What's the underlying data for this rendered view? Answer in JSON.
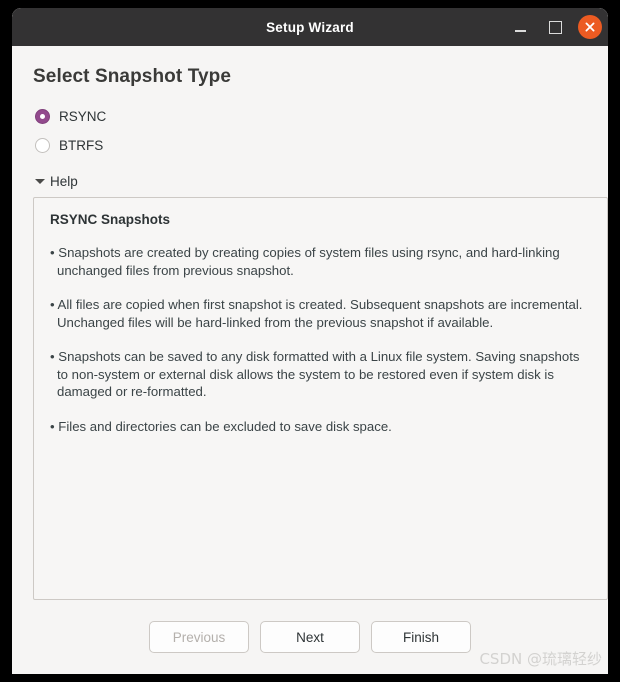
{
  "window": {
    "title": "Setup Wizard",
    "controls": {
      "minimize": "minimize",
      "maximize": "maximize",
      "close": "close"
    },
    "close_button_color": "#ec5b22",
    "titlebar_color": "#333233"
  },
  "page": {
    "title": "Select Snapshot Type",
    "accent_color": "#924a8d",
    "background_color": "#f6f5f4"
  },
  "snapshot_type": {
    "selected": "RSYNC",
    "options": [
      {
        "label": "RSYNC",
        "selected": true
      },
      {
        "label": "BTRFS",
        "selected": false
      }
    ]
  },
  "help": {
    "toggle_label": "Help",
    "expanded": true,
    "heading": "RSYNC Snapshots",
    "bullets": [
      "• Snapshots are created by creating copies of system files using rsync, and hard-linking unchanged files from previous snapshot.",
      "• All files are copied when first snapshot is created. Subsequent snapshots are incremental. Unchanged files will be hard-linked from the previous snapshot if available.",
      "• Snapshots can be saved to any disk formatted with a Linux file system. Saving snapshots to non-system or external disk allows the system to be restored even if system disk is damaged or re-formatted.",
      "• Files and directories can be excluded to save disk space."
    ]
  },
  "footer": {
    "previous_label": "Previous",
    "previous_disabled": true,
    "next_label": "Next",
    "finish_label": "Finish"
  },
  "watermark": {
    "text": "CSDN @琉璃轻纱"
  }
}
